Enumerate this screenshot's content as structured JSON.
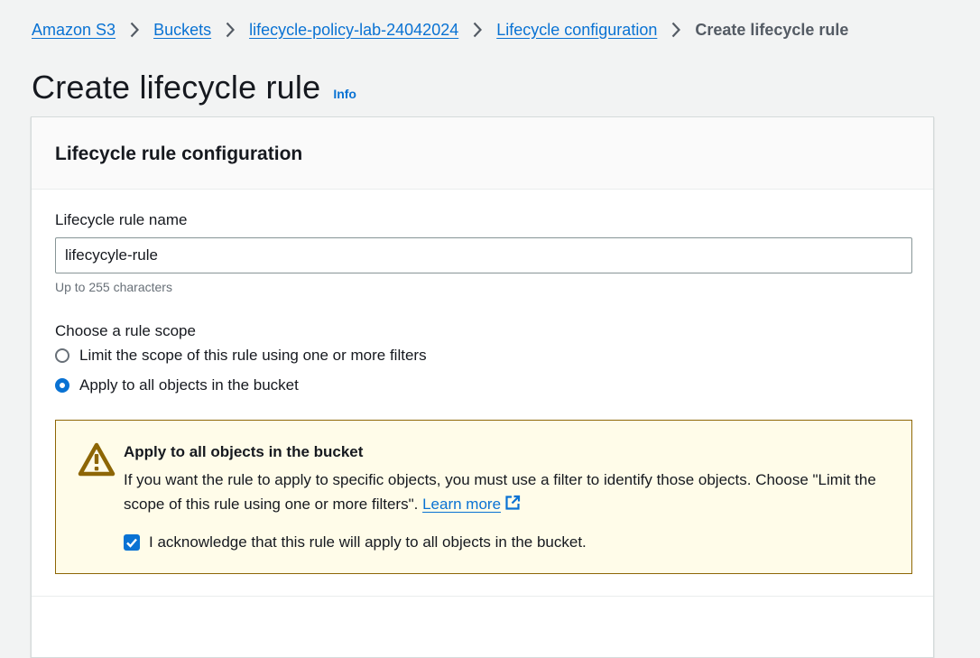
{
  "breadcrumb": {
    "items": [
      "Amazon S3",
      "Buckets",
      "lifecycle-policy-lab-24042024",
      "Lifecycle configuration"
    ],
    "current": "Create lifecycle rule"
  },
  "page": {
    "title": "Create lifecycle rule",
    "info": "Info"
  },
  "card": {
    "title": "Lifecycle rule configuration",
    "rule_name": {
      "label": "Lifecycle rule name",
      "value": "lifecycyle-rule",
      "hint": "Up to 255 characters"
    },
    "scope": {
      "label": "Choose a rule scope",
      "options": [
        {
          "label": "Limit the scope of this rule using one or more filters",
          "selected": false
        },
        {
          "label": "Apply to all objects in the bucket",
          "selected": true
        }
      ]
    },
    "alert": {
      "title": "Apply to all objects in the bucket",
      "body": "If you want the rule to apply to specific objects, you must use a filter to identify those objects. Choose \"Limit the scope of this rule using one or more filters\".",
      "link": "Learn more",
      "checkbox_label": "I acknowledge that this rule will apply to all objects in the bucket.",
      "checkbox_checked": true
    }
  },
  "icons": {
    "breadcrumb_separator": "chevron-right-icon",
    "alert": "warning-icon",
    "external_link": "external-link-icon",
    "checkbox": "check-icon"
  },
  "colors": {
    "link": "#0972d3",
    "warning_bg": "#fffce9",
    "warning_border": "#8d6605",
    "text": "#16191f",
    "page_bg": "#f2f3f3"
  }
}
